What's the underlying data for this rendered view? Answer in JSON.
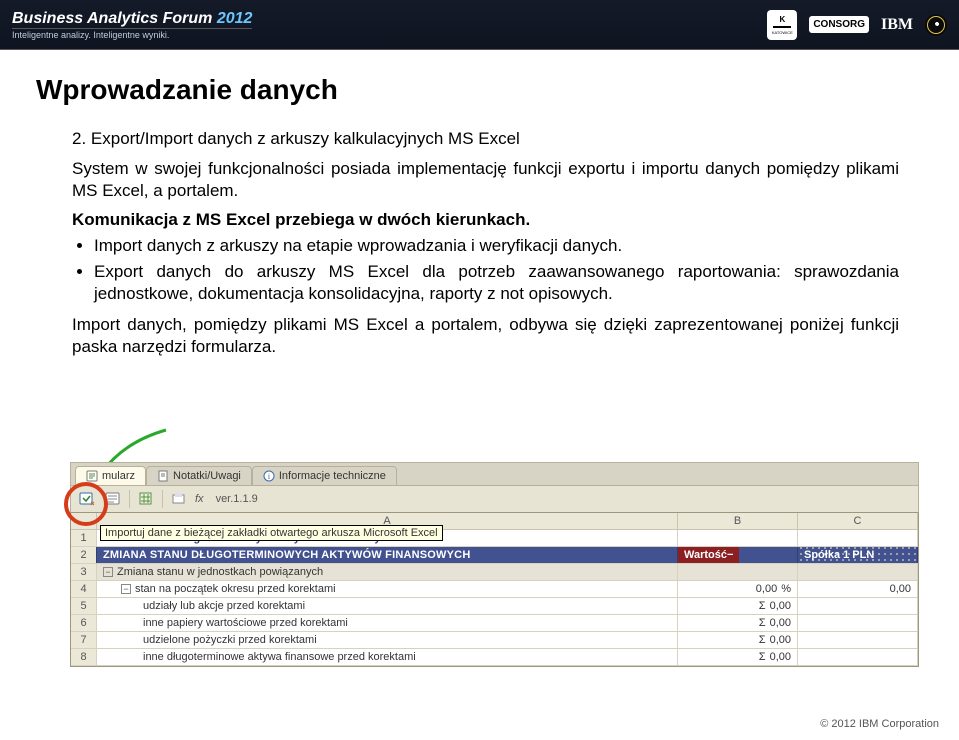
{
  "header": {
    "title_main": "Business Analytics Forum",
    "title_year": "2012",
    "subtitle": "Inteligentne analizy. Inteligentne wyniki.",
    "logo_kw_top": "K",
    "logo_kw_bottom": "KATOWICE",
    "logo_consorg": "CONSORG",
    "logo_ibm": "IBM"
  },
  "slide": {
    "title": "Wprowadzanie danych",
    "item_head": "2. Export/Import danych z arkuszy kalkulacyjnych MS Excel",
    "p1": "System w swojej funkcjonalności posiada implementację funkcji exportu i importu danych pomiędzy plikami MS Excel, a portalem.",
    "p2": "Komunikacja z MS Excel przebiega w dwóch kierunkach.",
    "b1": "Import danych z arkuszy na etapie wprowadzania i weryfikacji danych.",
    "b2": "Export danych do arkuszy MS Excel dla potrzeb zaawansowanego raportowania: sprawozdania jednostkowe, dokumentacja konsolidacyjna, raporty z not opisowych.",
    "p3": "Import danych, pomiędzy plikami MS Excel a portalem, odbywa się dzięki zaprezentowanej poniżej funkcji paska narzędzi formularza."
  },
  "app": {
    "tabs": {
      "t0": "mularz",
      "t1": "Notatki/Uwagi",
      "t2": "Informacje techniczne"
    },
    "version": "ver.1.1.9",
    "fx": "fx",
    "tooltip": "Importuj dane z bieżącej zakładki otwartego arkusza Microsoft Excel",
    "columns": {
      "a": "A",
      "b": "B",
      "c": "C"
    },
    "rows": {
      "r1": "Zmiana stanu długoterminowych aktywów finansowych",
      "r2_label": "ZMIANA STANU DŁUGOTERMINOWYCH AKTYWÓW FINANSOWYCH",
      "r2_wartosc": "Wartość",
      "r2_spolka": "Spółka 1 PLN",
      "r3": "Zmiana stanu w jednostkach powiązanych",
      "r4_label": "stan na początek okresu przed korektami",
      "r4_b": "0,00",
      "r4_c": "0,00",
      "r5_label": "udziały lub akcje przed korektami",
      "r5_b": "0,00",
      "r6_label": "inne papiery wartościowe przed korektami",
      "r6_b": "0,00",
      "r7_label": "udzielone pożyczki przed korektami",
      "r7_b": "0,00",
      "r8_label": "inne długoterminowe aktywa finansowe przed korektami",
      "r8_b": "0,00"
    },
    "sigma": "Σ",
    "pct": "%"
  },
  "footer": "© 2012 IBM Corporation"
}
